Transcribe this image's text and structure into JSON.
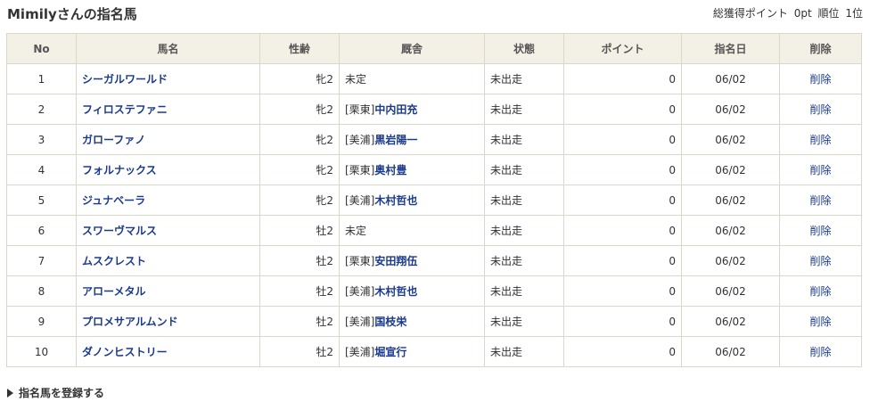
{
  "page": {
    "title": "Mimilyさんの指名馬"
  },
  "summary": {
    "total_label": "総獲得ポイント",
    "total_value": "0pt",
    "rank_label": "順位",
    "rank_value": "1位"
  },
  "table": {
    "columns": [
      "No",
      "馬名",
      "性齢",
      "厩舎",
      "状態",
      "ポイント",
      "指名日",
      "削除"
    ],
    "rows": [
      {
        "no": "1",
        "name": "シーガルワールド",
        "sex_age": "牝2",
        "stable_prefix": "",
        "trainer": "",
        "stable_text": "未定",
        "status": "未出走",
        "points": "0",
        "date": "06/02",
        "delete": "削除"
      },
      {
        "no": "2",
        "name": "フィロステファニ",
        "sex_age": "牝2",
        "stable_prefix": "[栗東]",
        "trainer": "中内田充",
        "stable_text": "",
        "status": "未出走",
        "points": "0",
        "date": "06/02",
        "delete": "削除"
      },
      {
        "no": "3",
        "name": "ガローファノ",
        "sex_age": "牝2",
        "stable_prefix": "[美浦]",
        "trainer": "黒岩陽一",
        "stable_text": "",
        "status": "未出走",
        "points": "0",
        "date": "06/02",
        "delete": "削除"
      },
      {
        "no": "4",
        "name": "フォルナックス",
        "sex_age": "牝2",
        "stable_prefix": "[栗東]",
        "trainer": "奥村豊",
        "stable_text": "",
        "status": "未出走",
        "points": "0",
        "date": "06/02",
        "delete": "削除"
      },
      {
        "no": "5",
        "name": "ジュナベーラ",
        "sex_age": "牝2",
        "stable_prefix": "[美浦]",
        "trainer": "木村哲也",
        "stable_text": "",
        "status": "未出走",
        "points": "0",
        "date": "06/02",
        "delete": "削除"
      },
      {
        "no": "6",
        "name": "スワーヴマルス",
        "sex_age": "牡2",
        "stable_prefix": "",
        "trainer": "",
        "stable_text": "未定",
        "status": "未出走",
        "points": "0",
        "date": "06/02",
        "delete": "削除"
      },
      {
        "no": "7",
        "name": "ムスクレスト",
        "sex_age": "牡2",
        "stable_prefix": "[栗東]",
        "trainer": "安田翔伍",
        "stable_text": "",
        "status": "未出走",
        "points": "0",
        "date": "06/02",
        "delete": "削除"
      },
      {
        "no": "8",
        "name": "アローメタル",
        "sex_age": "牡2",
        "stable_prefix": "[美浦]",
        "trainer": "木村哲也",
        "stable_text": "",
        "status": "未出走",
        "points": "0",
        "date": "06/02",
        "delete": "削除"
      },
      {
        "no": "9",
        "name": "プロメサアルムンド",
        "sex_age": "牡2",
        "stable_prefix": "[美浦]",
        "trainer": "国枝栄",
        "stable_text": "",
        "status": "未出走",
        "points": "0",
        "date": "06/02",
        "delete": "削除"
      },
      {
        "no": "10",
        "name": "ダノンヒストリー",
        "sex_age": "牡2",
        "stable_prefix": "[美浦]",
        "trainer": "堀宣行",
        "stable_text": "",
        "status": "未出走",
        "points": "0",
        "date": "06/02",
        "delete": "削除"
      }
    ]
  },
  "footer": {
    "register_label": "指名馬を登録する",
    "register_icon": "triangle-right-icon"
  }
}
